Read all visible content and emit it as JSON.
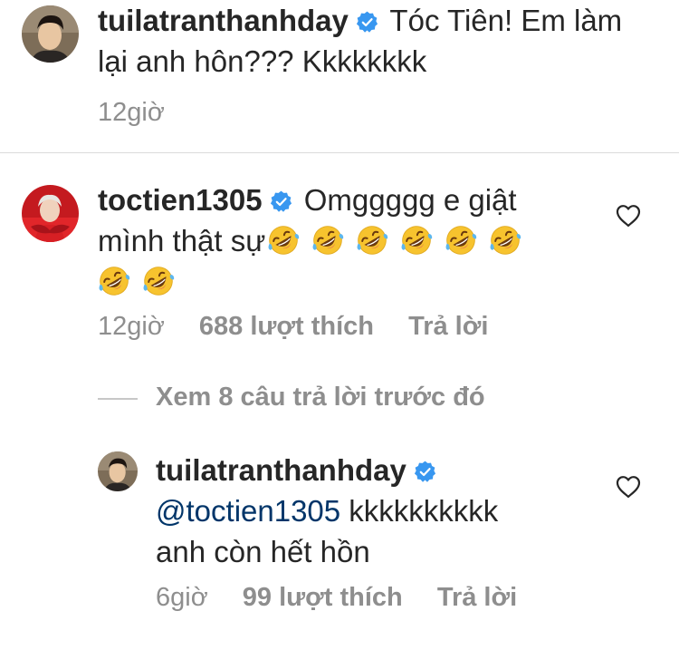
{
  "main_comment": {
    "username": "tuilatranthanhday",
    "text_line1": " Tóc Tiên! Em làm",
    "text_line2": "lại anh hôn??? Kkkkkkkk",
    "time": "12giờ"
  },
  "comment_tien": {
    "username": "toctien1305",
    "text_line1": " Omggggg e giật",
    "text_line2": "mình thật sự",
    "emoji": "rolling-on-floor-laughing",
    "emoji_count": 8,
    "time": "12giờ",
    "likes": "688 lượt thích",
    "reply_label": "Trả lời"
  },
  "view_replies": {
    "label": "Xem 8 câu trả lời trước đó"
  },
  "reply": {
    "username": "tuilatranthanhday",
    "mention": "@toctien1305",
    "text_line1_rest": " kkkkkkkkkk",
    "text_line2": "anh còn hết hồn",
    "time": "6giờ",
    "likes": "99 lượt thích",
    "reply_label": "Trả lời"
  },
  "colors": {
    "text": "#262626",
    "meta": "#8e8e8e",
    "verified_badge": "#3897f0",
    "mention": "#003569",
    "divider": "#dbdbdb"
  }
}
